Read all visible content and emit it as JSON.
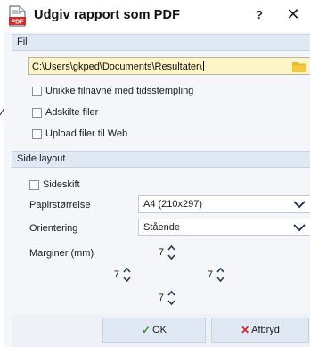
{
  "window": {
    "title": "Udgiv rapport som PDF",
    "help": "?",
    "close": "✕",
    "pdf_icon_label": "PDF"
  },
  "fil_section": {
    "header": "Fil",
    "path_value": "C:\\Users\\gkped\\Documents\\Resultater\\",
    "options": [
      {
        "label": "Unikke filnavne med tidsstempling",
        "checked": false
      },
      {
        "label": "Adskilte filer",
        "checked": false
      },
      {
        "label": "Upload filer til Web",
        "checked": false
      }
    ]
  },
  "layout_section": {
    "header": "Side layout",
    "page_break_label": "Sideskift",
    "page_break_checked": false,
    "paper_size_label": "Papirstørrelse",
    "paper_size_value": "A4 (210x297)",
    "orientation_label": "Orientering",
    "orientation_value": "Stående",
    "margins_label": "Marginer (mm)",
    "margin_top": "7",
    "margin_left": "7",
    "margin_right": "7",
    "margin_bottom": "7"
  },
  "buttons": {
    "ok_label": "OK",
    "cancel_label": "Afbryd"
  },
  "colors": {
    "ok_icon": "#2f9a2f",
    "cancel_icon": "#d62020",
    "pdf_icon": "#d42a2a",
    "folder": "#e9b92a"
  }
}
